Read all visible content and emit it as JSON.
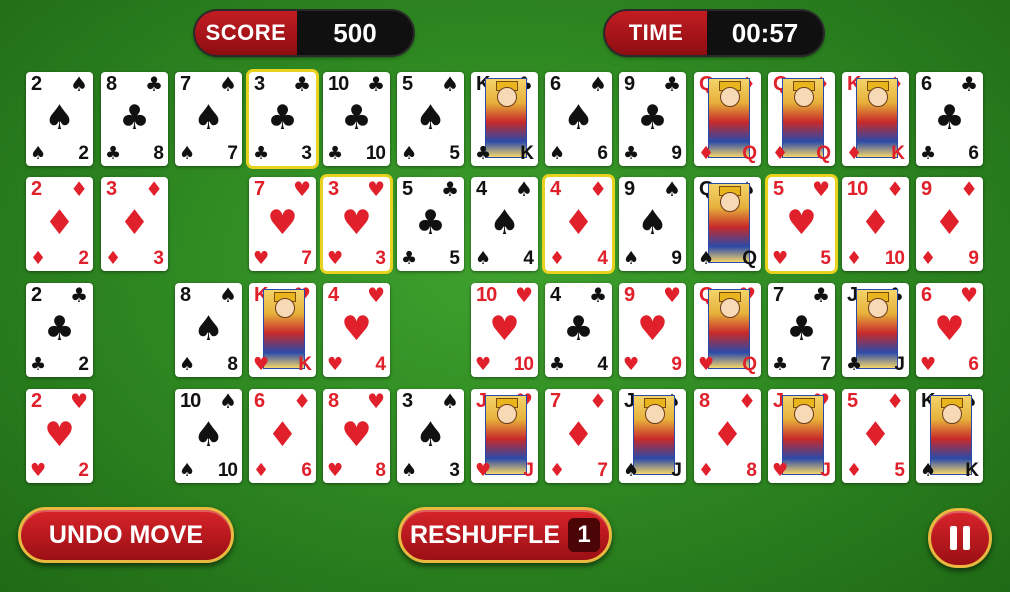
{
  "hud": {
    "score_label": "SCORE",
    "score_value": "500",
    "time_label": "TIME",
    "time_value": "00:57"
  },
  "buttons": {
    "undo_label": "UNDO MOVE",
    "reshuffle_label": "RESHUFFLE",
    "reshuffle_count": "1",
    "pause_icon": "pause-icon"
  },
  "colors": {
    "felt": "#2f8a22",
    "button_red": "#c21d22",
    "button_border": "#e9b93f",
    "selection": "#e8d21d",
    "red_suit": "#e0202a"
  },
  "rows": [
    [
      {
        "r": "2",
        "s": "♠"
      },
      {
        "r": "8",
        "s": "♣"
      },
      {
        "r": "7",
        "s": "♠"
      },
      {
        "r": "3",
        "s": "♣",
        "sel": true
      },
      {
        "r": "10",
        "s": "♣"
      },
      {
        "r": "5",
        "s": "♠"
      },
      {
        "r": "K",
        "s": "♣"
      },
      {
        "r": "6",
        "s": "♠"
      },
      {
        "r": "9",
        "s": "♣"
      },
      {
        "r": "Q",
        "s": "♦"
      },
      {
        "r": "Q",
        "s": "♦"
      },
      {
        "r": "K",
        "s": "♦"
      },
      {
        "r": "6",
        "s": "♣"
      }
    ],
    [
      {
        "r": "2",
        "s": "♦"
      },
      {
        "r": "3",
        "s": "♦"
      },
      null,
      {
        "r": "7",
        "s": "♥"
      },
      {
        "r": "3",
        "s": "♥",
        "sel": true
      },
      {
        "r": "5",
        "s": "♣"
      },
      {
        "r": "4",
        "s": "♠"
      },
      {
        "r": "4",
        "s": "♦",
        "sel": true
      },
      {
        "r": "9",
        "s": "♠"
      },
      {
        "r": "Q",
        "s": "♠"
      },
      {
        "r": "5",
        "s": "♥",
        "sel": true
      },
      {
        "r": "10",
        "s": "♦"
      },
      {
        "r": "9",
        "s": "♦"
      }
    ],
    [
      {
        "r": "2",
        "s": "♣"
      },
      null,
      {
        "r": "8",
        "s": "♠"
      },
      {
        "r": "K",
        "s": "♥"
      },
      {
        "r": "4",
        "s": "♥"
      },
      null,
      {
        "r": "10",
        "s": "♥"
      },
      {
        "r": "4",
        "s": "♣"
      },
      {
        "r": "9",
        "s": "♥"
      },
      {
        "r": "Q",
        "s": "♥"
      },
      {
        "r": "7",
        "s": "♣"
      },
      {
        "r": "J",
        "s": "♣"
      },
      {
        "r": "6",
        "s": "♥"
      }
    ],
    [
      {
        "r": "2",
        "s": "♥"
      },
      null,
      {
        "r": "10",
        "s": "♠"
      },
      {
        "r": "6",
        "s": "♦"
      },
      {
        "r": "8",
        "s": "♥"
      },
      {
        "r": "3",
        "s": "♠"
      },
      {
        "r": "J",
        "s": "♥"
      },
      {
        "r": "7",
        "s": "♦"
      },
      {
        "r": "J",
        "s": "♠"
      },
      {
        "r": "8",
        "s": "♦"
      },
      {
        "r": "J",
        "s": "♥"
      },
      {
        "r": "5",
        "s": "♦"
      },
      {
        "r": "K",
        "s": "♠"
      }
    ]
  ]
}
